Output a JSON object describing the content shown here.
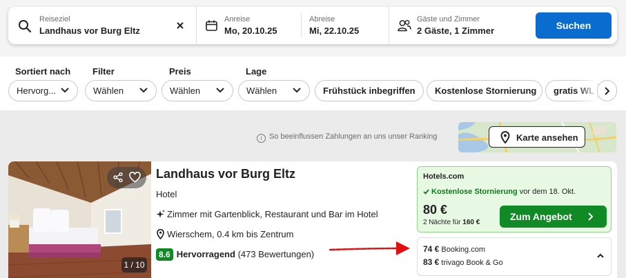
{
  "search": {
    "destination_label": "Reiseziel",
    "destination_value": "Landhaus vor Burg Eltz",
    "checkin_label": "Anreise",
    "checkin_value": "Mo, 20.10.25",
    "checkout_label": "Abreise",
    "checkout_value": "Mi, 22.10.25",
    "guests_label": "Gäste und Zimmer",
    "guests_value": "2 Gäste, 1 Zimmer",
    "search_button": "Suchen",
    "icons": [
      "search-icon",
      "clear-icon",
      "calendar-icon",
      "guests-icon"
    ]
  },
  "filters": {
    "sort": {
      "heading": "Sortiert nach",
      "value": "Hervorg..."
    },
    "filter": {
      "heading": "Filter",
      "value": "Wählen"
    },
    "price": {
      "heading": "Preis",
      "value": "Wählen"
    },
    "location": {
      "heading": "Lage",
      "value": "Wählen"
    },
    "chips": [
      "Frühstück inbegriffen",
      "Kostenlose Stornierung",
      "gratis WL"
    ]
  },
  "ranking_note": "So beeinflussen Zahlungen an uns unser Ranking",
  "map": {
    "button_label": "Karte ansehen"
  },
  "hotel": {
    "name": "Landhaus vor Burg Eltz",
    "type": "Hotel",
    "amenities": "Zimmer mit Gartenblick, Restaurant und Bar im Hotel",
    "location": "Wierschem, 0.4 km bis Zentrum",
    "rating_score": "8.6",
    "rating_word": "Hervorragend",
    "rating_count": "(473 Bewertungen)",
    "image_counter": "1 / 10",
    "offer": {
      "provider": "Hotels.com",
      "cancellation_bold": "Kostenlose Stornierung",
      "cancellation_rest": " vor dem 18. Okt.",
      "price": "80 €",
      "nights_prefix": "2 Nächte für ",
      "nights_total": "160 €",
      "deal_button": "Zum Angebot"
    },
    "other_offers": [
      {
        "price": "74 €",
        "provider": "Booking.com"
      },
      {
        "price": "83 €",
        "provider": "trivago Book & Go"
      }
    ]
  },
  "colors": {
    "primary_blue": "#0a6ccf",
    "deal_green": "#0f8a24",
    "offer_bg": "#e8f9e3",
    "annotation_arrow": "#e01010"
  }
}
